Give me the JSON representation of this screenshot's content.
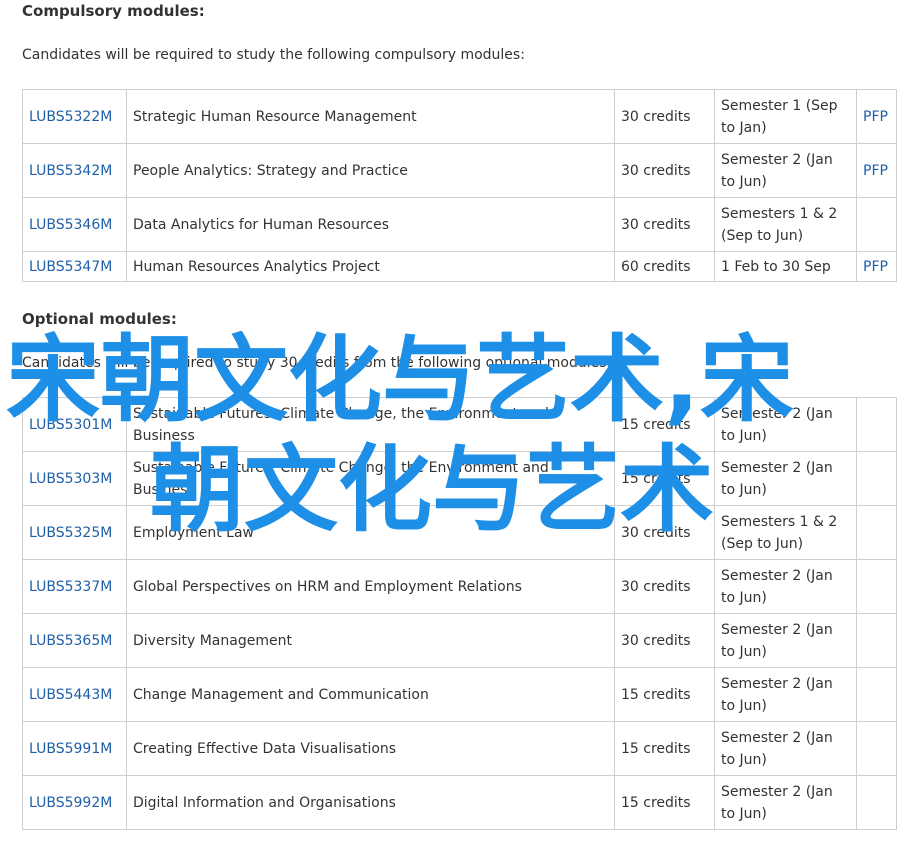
{
  "compulsory": {
    "heading": "Compulsory modules:",
    "intro": "Candidates will be required to study the following compulsory modules:",
    "rows": [
      {
        "code": "LUBS5322M",
        "title": "Strategic Human Resource Management",
        "credits": "30 credits",
        "semester": "Semester 1 (Sep to Jan)",
        "pfp": "PFP"
      },
      {
        "code": "LUBS5342M",
        "title": "People Analytics: Strategy and Practice",
        "credits": "30 credits",
        "semester": "Semester 2 (Jan to Jun)",
        "pfp": "PFP"
      },
      {
        "code": "LUBS5346M",
        "title": "Data Analytics for Human Resources",
        "credits": "30 credits",
        "semester": "Semesters 1 & 2 (Sep to Jun)",
        "pfp": ""
      },
      {
        "code": "LUBS5347M",
        "title": "Human Resources Analytics Project",
        "credits": "60 credits",
        "semester": "1 Feb to 30 Sep",
        "pfp": "PFP"
      }
    ]
  },
  "optional": {
    "heading": "Optional modules:",
    "intro": "Candidates will be required to study 30 credits from the following optional modules:",
    "rows": [
      {
        "code": "LUBS5301M",
        "title": "Sustainable Futures: Climate Change, the Environment and Business",
        "credits": "15 credits",
        "semester": "Semester 2 (Jan to Jun)",
        "pfp": ""
      },
      {
        "code": "LUBS5303M",
        "title": "Sustainable Futures: Climate Change, the Environment and Business",
        "credits": "15 credits",
        "semester": "Semester 2 (Jan to Jun)",
        "pfp": ""
      },
      {
        "code": "LUBS5325M",
        "title": "Employment Law",
        "credits": "30 credits",
        "semester": "Semesters 1 & 2 (Sep to Jun)",
        "pfp": ""
      },
      {
        "code": "LUBS5337M",
        "title": "Global Perspectives on HRM and Employment Relations",
        "credits": "30 credits",
        "semester": "Semester 2 (Jan to Jun)",
        "pfp": ""
      },
      {
        "code": "LUBS5365M",
        "title": "Diversity Management",
        "credits": "30 credits",
        "semester": "Semester 2 (Jan to Jun)",
        "pfp": ""
      },
      {
        "code": "LUBS5443M",
        "title": "Change Management and Communication",
        "credits": "15 credits",
        "semester": "Semester 2 (Jan to Jun)",
        "pfp": ""
      },
      {
        "code": "LUBS5991M",
        "title": "Creating Effective Data Visualisations",
        "credits": "15 credits",
        "semester": "Semester 2 (Jan to Jun)",
        "pfp": ""
      },
      {
        "code": "LUBS5992M",
        "title": "Digital Information and Organisations",
        "credits": "15 credits",
        "semester": "Semester 2 (Jan to Jun)",
        "pfp": ""
      }
    ]
  },
  "overlay": {
    "line1": "宋朝文化与艺术,宋",
    "line2": "朝文化与艺术",
    "color": "#1e8fe6"
  }
}
